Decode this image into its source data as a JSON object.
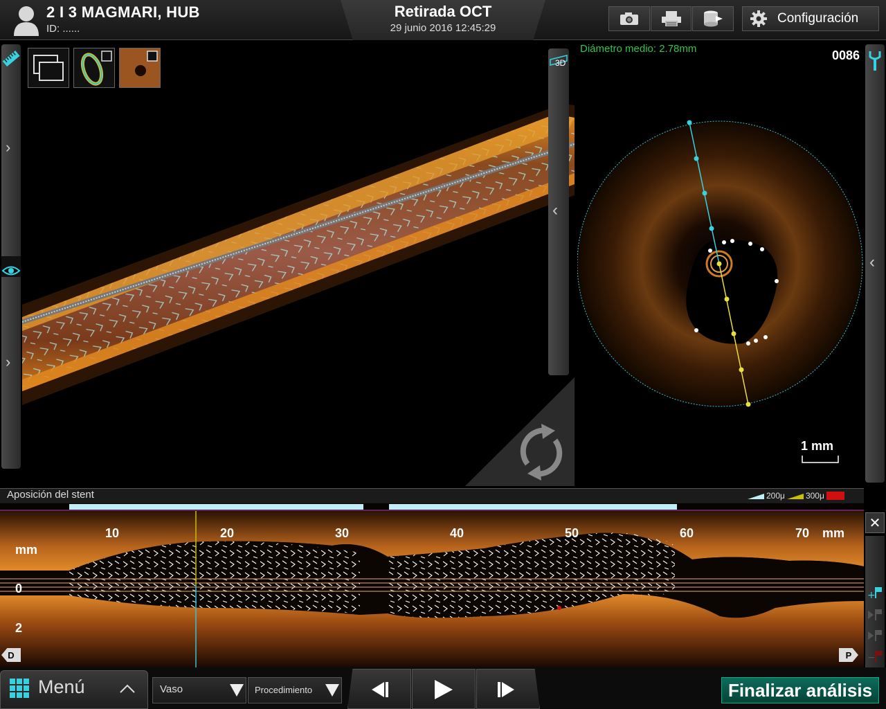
{
  "header": {
    "patient_name": "2 I 3 MAGMARI, HUB",
    "patient_id": "ID:  ......",
    "title": "Retirada OCT",
    "datetime": "29 junio 2016 12:45:29",
    "tools": [
      {
        "icon": "camera-icon"
      },
      {
        "icon": "printer-icon"
      },
      {
        "icon": "export-icon"
      }
    ],
    "config_label": "Configuración"
  },
  "view3d": {
    "badge_3d": "3D"
  },
  "cross_section": {
    "mean_diameter": "Diámetro medio:  2.78mm",
    "frame_number": "0086",
    "scale": "1 mm"
  },
  "longitudinal": {
    "title": "Aposición del stent",
    "legend": [
      "200μ",
      "300μ"
    ],
    "legend_colors": [
      "#bfeff5",
      "#c8c000",
      "#d01010"
    ],
    "x_ticks": [
      "10",
      "20",
      "30",
      "40",
      "50",
      "60",
      "70"
    ],
    "x_unit": "mm",
    "y_unit": "mm",
    "y_ticks": [
      "0",
      "2"
    ],
    "distal_label": "D",
    "proximal_label": "P",
    "close_label": "✕"
  },
  "footer": {
    "menu_label": "Menú",
    "vessel_select": "Vaso",
    "procedure_select": "Procedimiento",
    "finish_label": "Finalizar análisis"
  },
  "colors": {
    "accent_green": "#2fc64a",
    "accent_cyan": "#39d0e0",
    "finish_bg": "#0e6b5a"
  }
}
